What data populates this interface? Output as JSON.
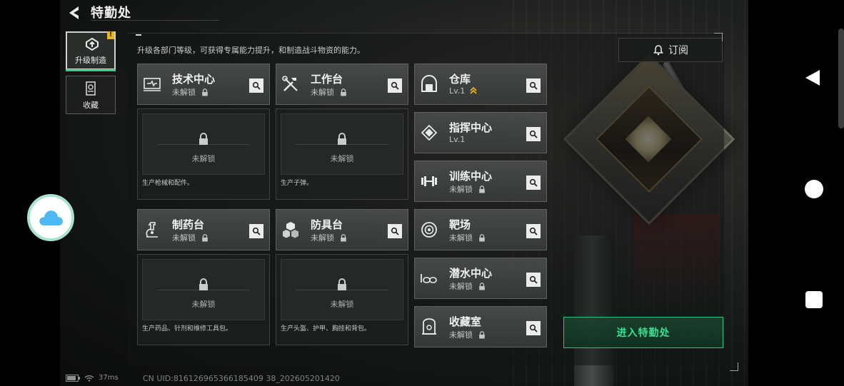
{
  "header": {
    "title": "特勤处"
  },
  "tabs": [
    {
      "label": "升级制造",
      "active": true,
      "badge": "!"
    },
    {
      "label": "收藏",
      "active": false
    }
  ],
  "description": "升级各部门等级，可获得专属能力提升，和制造战斗物资的能力。",
  "subscribe_label": "订阅",
  "stations": {
    "tech_center": {
      "name": "技术中心",
      "status": "未解锁",
      "locked": true
    },
    "workbench": {
      "name": "工作台",
      "status": "未解锁",
      "locked": true
    },
    "pharmacy": {
      "name": "制药台",
      "status": "未解锁",
      "locked": true
    },
    "armor_bench": {
      "name": "防具台",
      "status": "未解锁",
      "locked": true
    },
    "warehouse": {
      "name": "仓库",
      "status": "Lv.1",
      "upgradable": true
    },
    "command_center": {
      "name": "指挥中心",
      "status": "Lv.1"
    },
    "training_center": {
      "name": "训练中心",
      "status": "未解锁",
      "locked": true
    },
    "shooting_range": {
      "name": "靶场",
      "status": "未解锁",
      "locked": true
    },
    "diving_center": {
      "name": "潜水中心",
      "status": "未解锁",
      "locked": true
    },
    "collection_room": {
      "name": "收藏室",
      "status": "未解锁",
      "locked": true
    }
  },
  "production": {
    "tech_center": {
      "locked_text": "未解锁",
      "caption": "生产枪械和配件。"
    },
    "workbench": {
      "locked_text": "未解锁",
      "caption": "生产子弹。"
    },
    "pharmacy": {
      "locked_text": "未解锁",
      "caption": "生产药品、针剂和维修工具包。"
    },
    "armor_bench": {
      "locked_text": "未解锁",
      "caption": "生产头盔、护甲、胸挂和背包。"
    }
  },
  "enter_button": "进入特勤处",
  "hud": {
    "ping": "37ms",
    "uid": "CN UID:816126965366185409 38_202605201420"
  },
  "colors": {
    "accent_green": "#39e08f",
    "upgrade_gold": "#e6b325"
  }
}
